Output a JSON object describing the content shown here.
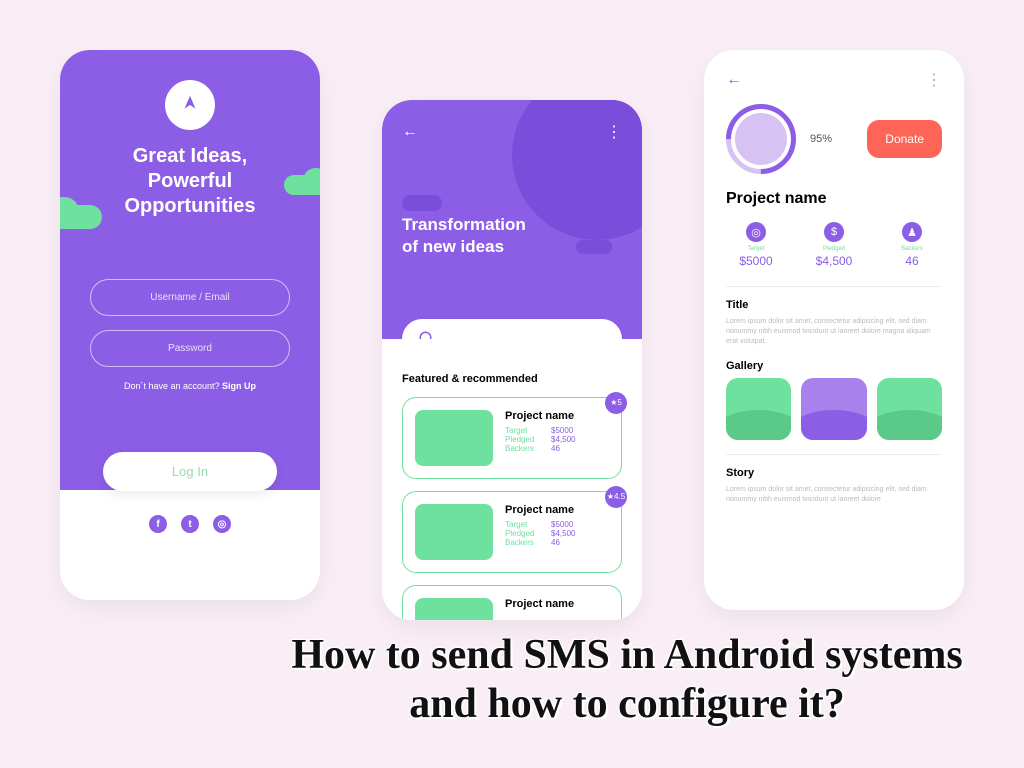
{
  "phone1": {
    "title_line1": "Great Ideas,",
    "title_line2": "Powerful",
    "title_line3": "Opportunities",
    "username_placeholder": "Username / Email",
    "password_placeholder": "Password",
    "signup_prefix": "Don´t have an account? ",
    "signup_link": "Sign Up",
    "login_label": "Log In"
  },
  "phone2": {
    "title_line1": "Transformation",
    "title_line2": "of new ideas",
    "section_label": "Featured & recommended",
    "cards": [
      {
        "name": "Project name",
        "target_label": "Target",
        "target": "$5000",
        "pledged_label": "Pledged",
        "pledged": "$4,500",
        "backers_label": "Backers",
        "backers": "46",
        "rating": "★5"
      },
      {
        "name": "Project name",
        "target_label": "Target",
        "target": "$5000",
        "pledged_label": "Pledged",
        "pledged": "$4,500",
        "backers_label": "Backers",
        "backers": "46",
        "rating": "★4.5"
      },
      {
        "name": "Project name"
      }
    ]
  },
  "phone3": {
    "progress": "95%",
    "donate_label": "Donate",
    "project_name": "Project name",
    "stats": [
      {
        "label": "Target",
        "value": "$5000",
        "icon": "◎"
      },
      {
        "label": "Pledged",
        "value": "$4,500",
        "icon": "$"
      },
      {
        "label": "Backers",
        "value": "46",
        "icon": "♟"
      }
    ],
    "title_label": "Title",
    "title_lorem": "Lorem ipsum dolor sit amet, consectetur adipiscing elit, sed diam nonummy nibh euismod tincidunt ut laoreet dolore magna aliquam erat volutpat.",
    "gallery_label": "Gallery",
    "story_label": "Story",
    "story_lorem": "Lorem ipsum dolor sit amet, consectetur adipiscing elit, sed diam nonummy nibh euismod tincidunt ut laoreet dolore"
  },
  "headline": "How to send SMS in Android systems and how to configure it?"
}
